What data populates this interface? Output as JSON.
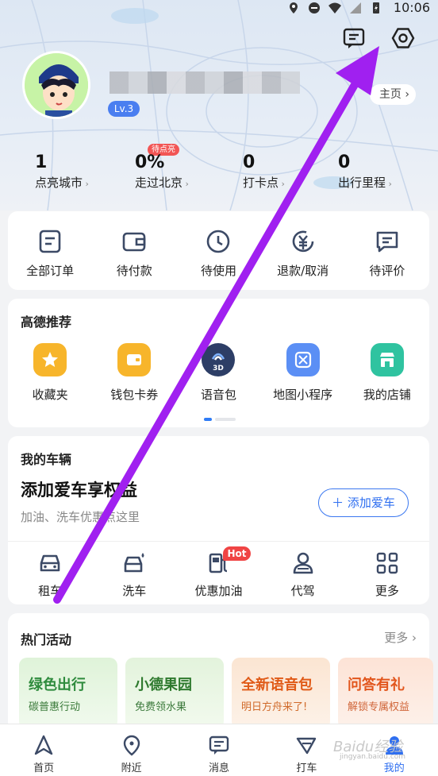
{
  "status_bar": {
    "time": "10:06"
  },
  "header": {
    "home_label": "主页",
    "level": "Lv.3",
    "stats": [
      {
        "value": "1",
        "label": "点亮城市"
      },
      {
        "value": "0%",
        "label": "走过北京",
        "badge": "待点亮"
      },
      {
        "value": "0",
        "label": "打卡点"
      },
      {
        "value": "0",
        "label": "出行里程"
      }
    ]
  },
  "orders": [
    {
      "label": "全部订单",
      "icon": "order-list-icon"
    },
    {
      "label": "待付款",
      "icon": "wallet-icon"
    },
    {
      "label": "待使用",
      "icon": "clock-icon"
    },
    {
      "label": "退款/取消",
      "icon": "refund-icon"
    },
    {
      "label": "待评价",
      "icon": "comment-icon"
    }
  ],
  "recommend": {
    "title": "高德推荐",
    "items": [
      {
        "label": "收藏夹",
        "color": "#f7b52b"
      },
      {
        "label": "钱包卡券",
        "color": "#f7b52b"
      },
      {
        "label": "语音包",
        "color": "#2d3e66"
      },
      {
        "label": "地图小程序",
        "color": "#5b8ff5"
      },
      {
        "label": "我的店铺",
        "color": "#2fc3a0"
      }
    ]
  },
  "vehicle": {
    "title": "我的车辆",
    "headline": "添加爱车享权益",
    "subtitle": "加油、洗车优惠点这里",
    "add_button": "添加爱车",
    "services": [
      {
        "label": "租车"
      },
      {
        "label": "洗车"
      },
      {
        "label": "优惠加油",
        "badge": "Hot"
      },
      {
        "label": "代驾"
      },
      {
        "label": "更多"
      }
    ]
  },
  "activities": {
    "title": "热门活动",
    "more": "更多",
    "cards": [
      {
        "title": "绿色出行",
        "subtitle": "碳普惠行动",
        "color": "#dff3d9",
        "text_color": "#2e8b3d"
      },
      {
        "title": "小德果园",
        "subtitle": "免费领水果",
        "color": "#e3f3dc",
        "text_color": "#2f7a2f"
      },
      {
        "title": "全新语音包",
        "subtitle": "明日方舟来了!",
        "color": "#fbe5d2",
        "text_color": "#e05a17"
      },
      {
        "title": "问答有礼",
        "subtitle": "解锁专属权益",
        "color": "#fde3d6",
        "text_color": "#e2561d"
      }
    ]
  },
  "tabbar": [
    {
      "label": "首页"
    },
    {
      "label": "附近"
    },
    {
      "label": "消息"
    },
    {
      "label": "打车"
    },
    {
      "label": "我的",
      "active": true
    }
  ],
  "watermark": {
    "text": "Baidu经验",
    "sub": "jingyan.baidu.com"
  },
  "colors": {
    "accent": "#2f6ff0",
    "annotation": "#a020f0"
  }
}
